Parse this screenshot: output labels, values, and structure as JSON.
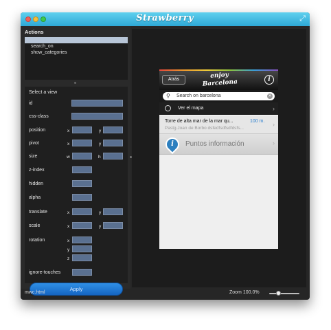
{
  "app": {
    "title": "Strawberry"
  },
  "actions": {
    "title": "Actions",
    "items": [
      {
        "label": ""
      },
      {
        "label": "search_on"
      },
      {
        "label": "show_categories"
      }
    ]
  },
  "properties": {
    "title": "Select a view",
    "labels": {
      "id": "id",
      "css_class": "css-class",
      "position": "position",
      "pivot": "pivot",
      "size": "size",
      "z_index": "z-index",
      "hidden": "hidden",
      "alpha": "alpha",
      "translate": "translate",
      "scale": "scale",
      "rotation": "rotation",
      "ignore_touches": "ignore-touches"
    },
    "axes": {
      "x": "x",
      "y": "y",
      "z": "z",
      "w": "w",
      "h": "h"
    },
    "apply_label": "Apply"
  },
  "status": {
    "file": "mwc.html",
    "zoom": "Zoom 100.0%",
    "zoom_level": 0.3
  },
  "phone": {
    "back": "Atrás",
    "logo_line1": "enjoy",
    "logo_line2": "Barcelona",
    "info_icon": "i",
    "search_placeholder": "Search on barcelona",
    "map_label": "Ver el mapa",
    "item": {
      "title": "Torre de alta mar de la mar qu...",
      "distance": "100 m.",
      "subtitle": "Pastg.Joan de Borbo dsfedfsdfsdfdsfs..."
    },
    "poi_label": "Puntos información"
  }
}
